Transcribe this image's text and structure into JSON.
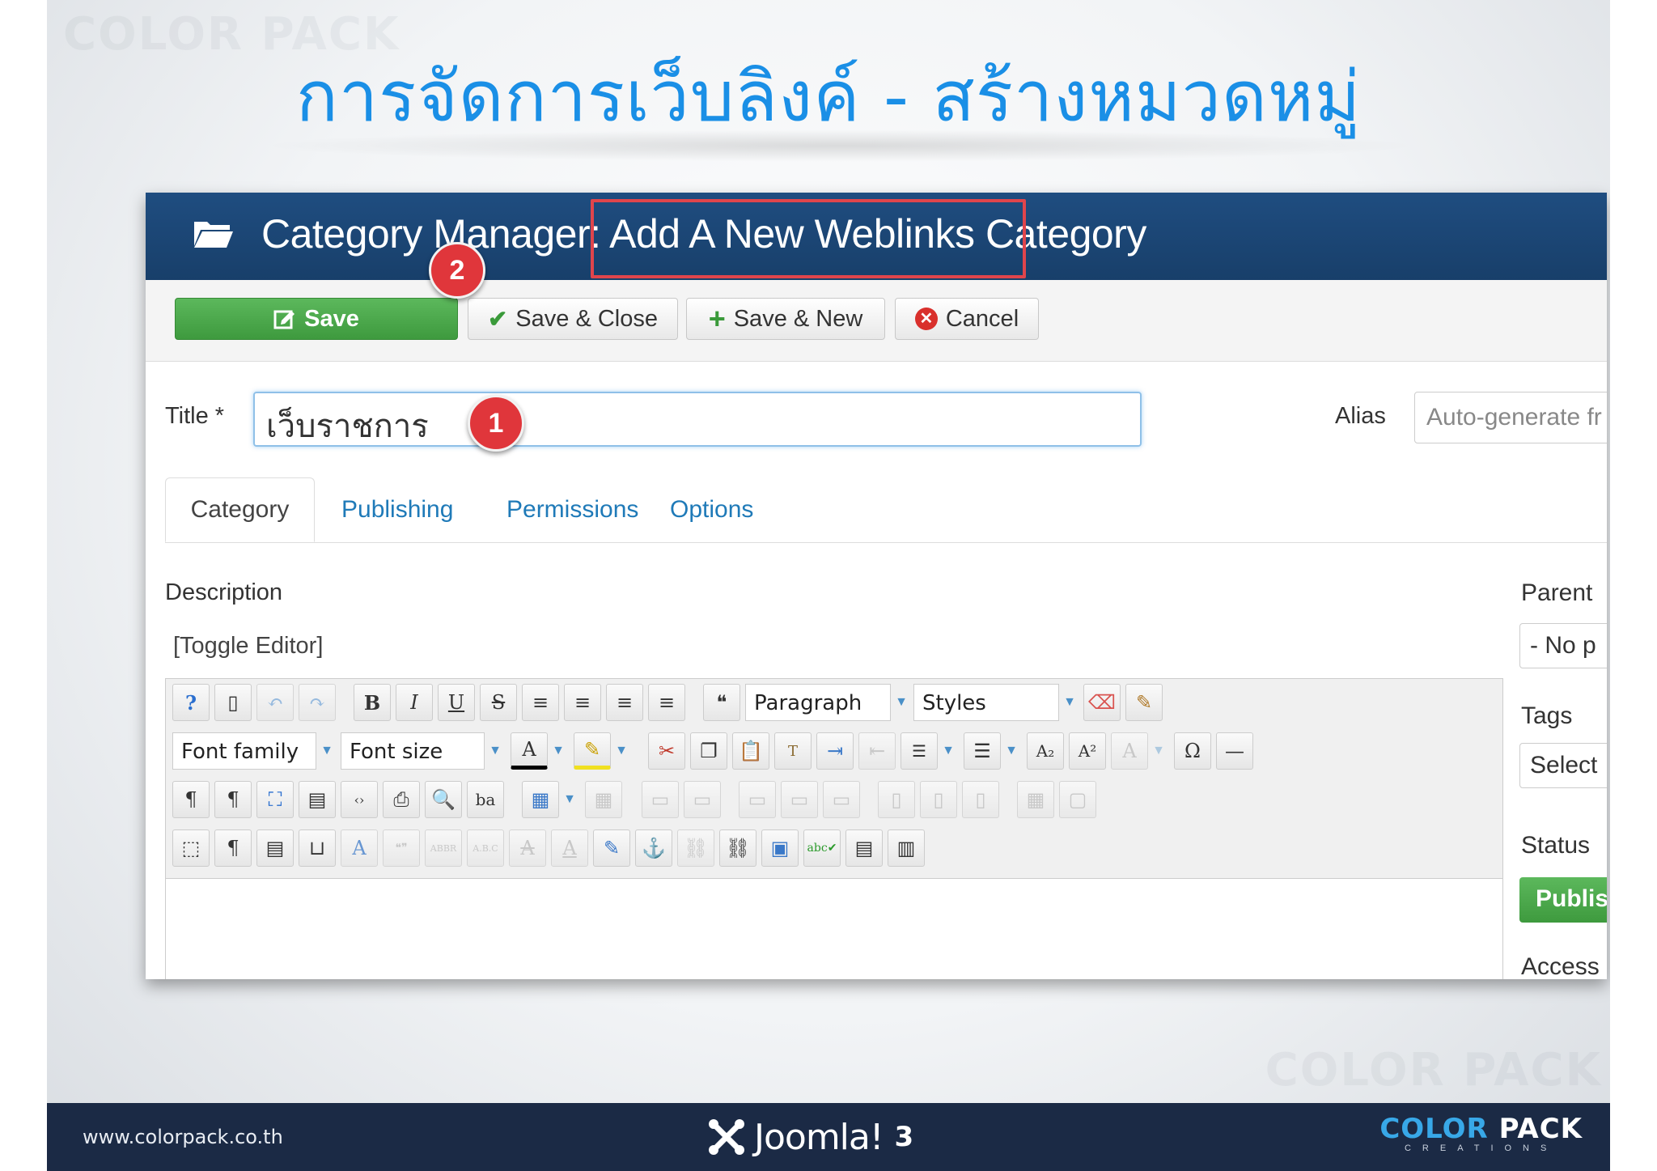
{
  "slide": {
    "title": "การจัดการเว็บลิงค์ - สร้างหมวดหมู่",
    "watermark": "COLOR PACK"
  },
  "header": {
    "title": "Category Manager: Add A New Weblinks Category"
  },
  "toolbar": {
    "save_label": "Save",
    "save_close_label": "Save & Close",
    "save_new_label": "Save & New",
    "cancel_label": "Cancel"
  },
  "badges": {
    "one": "1",
    "two": "2"
  },
  "form": {
    "title_label": "Title *",
    "title_value": "เว็บราชการ",
    "alias_label": "Alias",
    "alias_placeholder": "Auto-generate fr"
  },
  "tabs": [
    {
      "label": "Category",
      "active": true
    },
    {
      "label": "Publishing"
    },
    {
      "label": "Permissions"
    },
    {
      "label": "Options"
    }
  ],
  "editor": {
    "description_label": "Description",
    "toggle_label": "[Toggle Editor]",
    "format_select": "Paragraph",
    "styles_select": "Styles",
    "font_family_select": "Font family",
    "font_size_select": "Font size"
  },
  "sidebar": {
    "parent_label": "Parent",
    "parent_value": "- No p",
    "tags_label": "Tags",
    "tags_value": "Select",
    "status_label": "Status",
    "status_value": "Publis",
    "access_label": "Access"
  },
  "footer": {
    "url": "www.colorpack.co.th",
    "joomla_name": "Joomla!",
    "joomla_version": "3",
    "brand_main_1": "COLOR",
    "brand_main_2": "PACK",
    "brand_sub": "CREATIONS"
  },
  "colors": {
    "title_blue": "#1a8fe6",
    "header_navy": "#1f4d80",
    "save_green": "#5cb85c",
    "highlight_red": "#e0454c",
    "footer_navy": "#1b2a45"
  }
}
